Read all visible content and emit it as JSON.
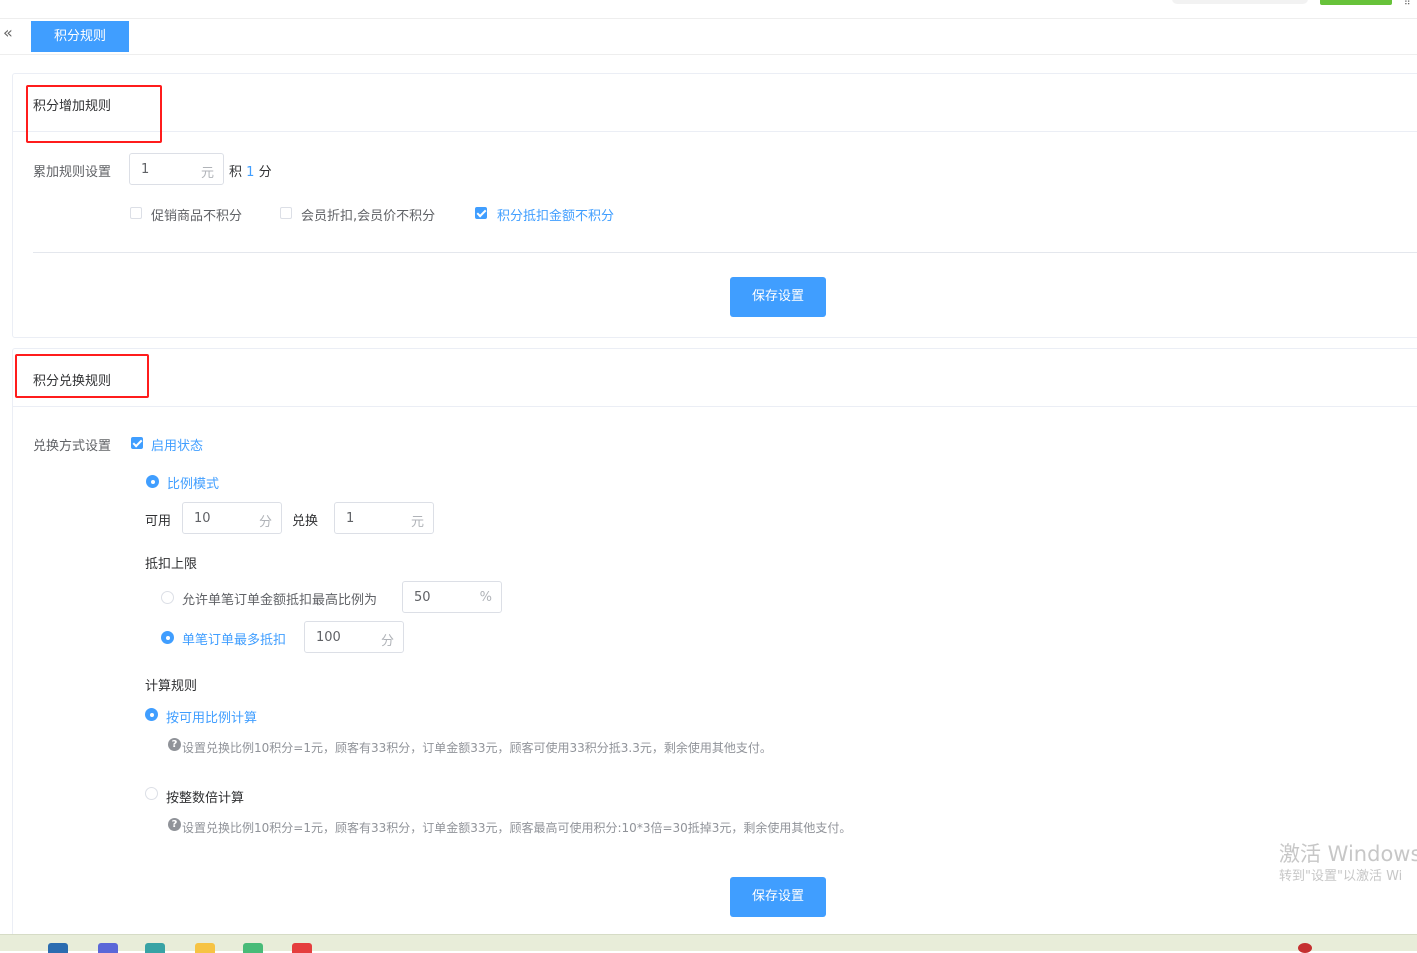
{
  "tabs": {
    "active_label": "积分规则"
  },
  "accrual_card": {
    "title": "积分增加规则",
    "rule_label": "累加规则设置",
    "amount_value": "1",
    "amount_unit": "元",
    "earn_prefix": "积",
    "earn_points": "1",
    "earn_suffix": "分",
    "options": [
      {
        "label": "促销商品不积分",
        "checked": false
      },
      {
        "label": "会员折扣,会员价不积分",
        "checked": false
      },
      {
        "label": "积分抵扣金额不积分",
        "checked": true
      }
    ],
    "save_label": "保存设置"
  },
  "exchange_card": {
    "title": "积分兑换规则",
    "method_label": "兑换方式设置",
    "enabled_label": "启用状态",
    "enabled": true,
    "mode_label": "比例模式",
    "usable_label": "可用",
    "usable_points": "10",
    "usable_unit": "分",
    "exchange_label": "兑换",
    "exchange_amount": "1",
    "exchange_unit": "元",
    "limit_title": "抵扣上限",
    "limit_ratio_label": "允许单笔订单金额抵扣最高比例为",
    "limit_ratio_value": "50",
    "limit_ratio_unit": "%",
    "limit_max_label": "单笔订单最多抵扣",
    "limit_max_value": "100",
    "limit_max_unit": "分",
    "calc_title": "计算规则",
    "calc_ratio_label": "按可用比例计算",
    "calc_ratio_hint": "设置兑换比例10积分=1元，顾客有33积分，订单金额33元，顾客可使用33积分抵3.3元，剩余使用其他支付。",
    "calc_multiple_label": "按整数倍计算",
    "calc_multiple_hint": "设置兑换比例10积分=1元，顾客有33积分，订单金额33元，顾客最高可使用积分:10*3倍=30抵掉3元，剩余使用其他支付。",
    "save_label": "保存设置"
  },
  "watermark": {
    "line1": "激活 Windows",
    "line2": "转到\"设置\"以激活 Wi"
  },
  "icons": {
    "collapse": "double-chevron-left-icon",
    "help": "question-circle-icon"
  },
  "colors": {
    "primary": "#409eff",
    "highlight_box": "#ff1c1c",
    "green": "#67c23a"
  }
}
